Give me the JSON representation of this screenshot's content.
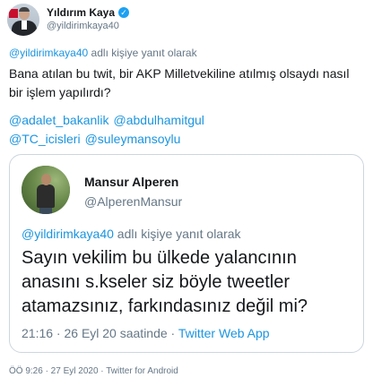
{
  "author": {
    "name": "Yıldırım Kaya",
    "verified": true,
    "handle": "@yildirimkaya40"
  },
  "reply_to": {
    "mention": "@yildirimkaya40",
    "suffix": " adlı kişiye yanıt olarak"
  },
  "tweet": {
    "text": "Bana atılan bu twit, bir AKP Milletvekiline atılmış olsaydı nasıl bir işlem yapılırdı?",
    "mentions": [
      "@adalet_bakanlik",
      "@abdulhamitgul",
      "@TC_icisleri",
      "@suleymansoylu"
    ]
  },
  "quoted": {
    "name": "Mansur Alperen",
    "handle": "@AlperenMansur",
    "reply_mention": "@yildirimkaya40",
    "reply_suffix": " adlı kişiye yanıt olarak",
    "text": "Sayın vekilim bu ülkede yalancının anasını s.kseler siz böyle tweetler atamazsınız, farkındasınız değil mi?",
    "time": "21:16 · 26 Eyl 20 saatinde · ",
    "source": "Twitter Web App"
  },
  "footer": "ÖÖ 9:26 · 27 Eyl 2020 · Twitter for Android",
  "colors": {
    "link": "#1b95e0",
    "muted": "#657786",
    "verified": "#1da1f2"
  }
}
